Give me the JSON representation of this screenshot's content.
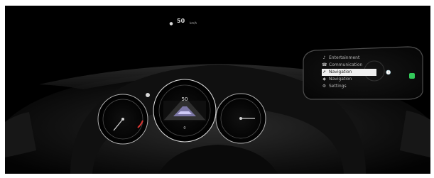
{
  "hud": {
    "speed": "50",
    "unit": "km/h",
    "icon": "speed-sign-icon"
  },
  "cluster": {
    "center_speed": "50",
    "bottom_value": "0"
  },
  "infotainment": {
    "menu": [
      {
        "label": "Entertainment",
        "icon": "music-note-icon"
      },
      {
        "label": "Communication",
        "icon": "phone-icon"
      },
      {
        "label": "Navigation",
        "icon": "navigation-icon"
      },
      {
        "label": "Navigation",
        "icon": "map-pin-icon"
      },
      {
        "label": "Settings",
        "icon": "gear-icon"
      }
    ],
    "selected_index": 2
  },
  "side_status": {
    "clock_symbol": "🕔",
    "badge_color": "#33c95a"
  }
}
